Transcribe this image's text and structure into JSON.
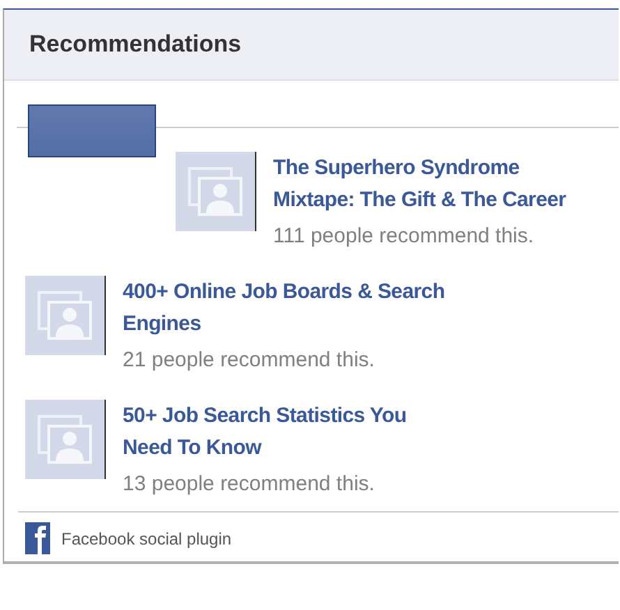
{
  "title": "Recommendations",
  "items": [
    {
      "title": "The Superhero Syndrome Mixtape: The Gift & The Career",
      "count": "111 people recommend this."
    },
    {
      "title": "400+ Online Job Boards & Search Engines",
      "count": "21 people recommend this."
    },
    {
      "title": "50+ Job Search Statistics You Need To Know",
      "count": "13 people recommend this."
    }
  ],
  "footer": {
    "text": "Facebook social plugin"
  }
}
